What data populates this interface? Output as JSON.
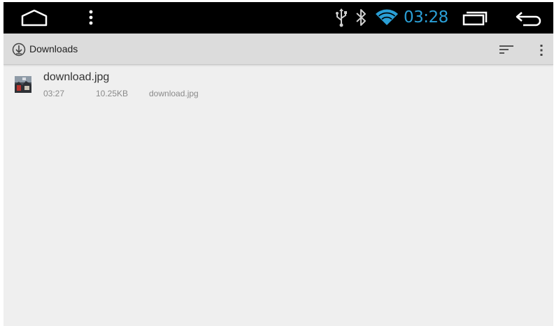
{
  "status_bar": {
    "time": "03:28",
    "icons": {
      "home": "home-icon",
      "menu": "menu-icon",
      "usb": "usb-icon",
      "bluetooth": "bluetooth-icon",
      "wifi": "wifi-icon",
      "recents": "recents-icon",
      "back": "back-icon"
    },
    "accent_color": "#2a9fd6"
  },
  "action_bar": {
    "title": "Downloads",
    "icons": {
      "app": "download-icon",
      "sort": "sort-icon",
      "overflow": "overflow-menu-icon"
    }
  },
  "downloads": [
    {
      "name": "download.jpg",
      "time": "03:27",
      "size": "10.25KB",
      "description": "download.jpg",
      "icon": "image-thumbnail"
    }
  ]
}
